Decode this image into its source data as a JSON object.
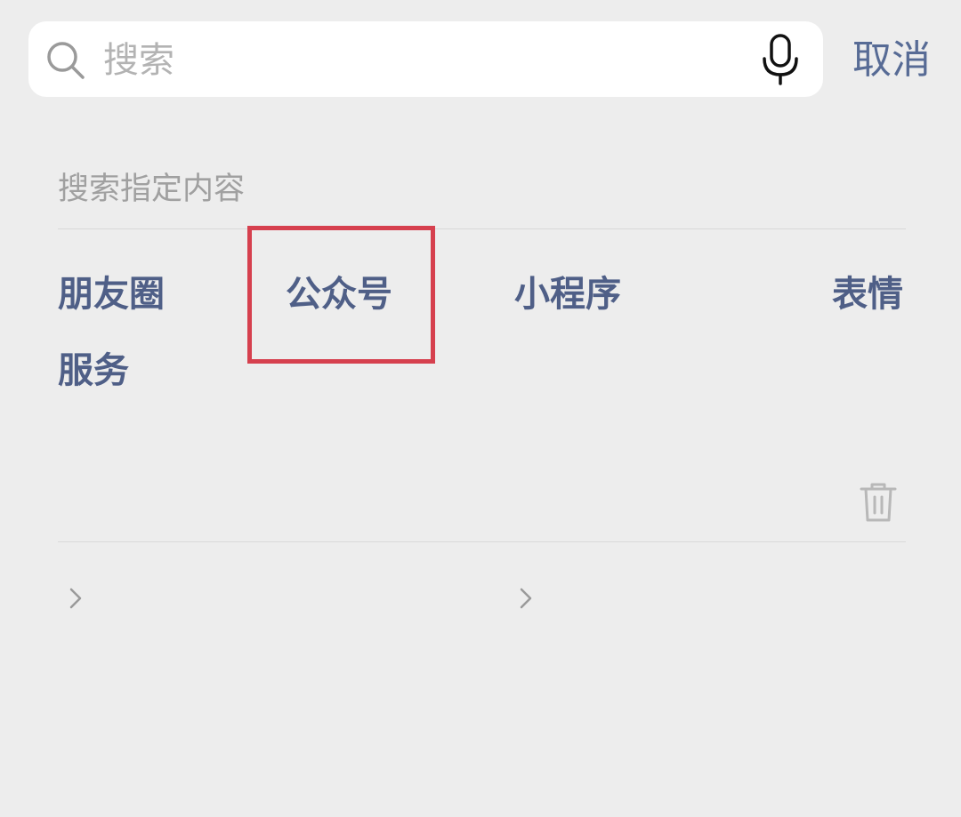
{
  "search": {
    "placeholder": "搜索",
    "cancel_label": "取消"
  },
  "specified_search": {
    "title": "搜索指定内容",
    "categories": [
      {
        "label": "朋友圈"
      },
      {
        "label": "公众号",
        "highlighted": true
      },
      {
        "label": "小程序"
      },
      {
        "label": "表情"
      },
      {
        "label": "服务"
      }
    ],
    "highlight_color": "#d6404e",
    "link_color": "#576b95"
  },
  "icons": {
    "search": "search-icon",
    "mic": "microphone-icon",
    "trash": "trash-icon",
    "chevron": "chevron-right-icon"
  }
}
